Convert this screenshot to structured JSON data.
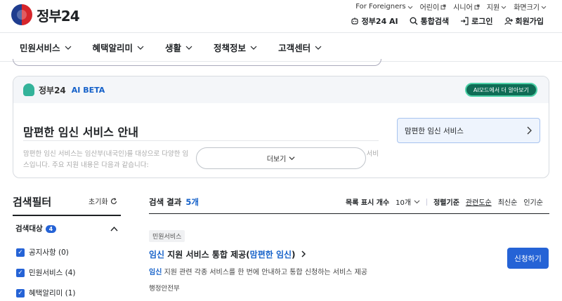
{
  "header": {
    "logo_text": "정부24",
    "util_links": [
      {
        "label": "For Foreigners",
        "icon": "chevron-down-icon"
      },
      {
        "label": "어린이",
        "icon": "external-link-icon"
      },
      {
        "label": "시니어",
        "icon": "external-link-icon"
      },
      {
        "label": "지원",
        "icon": "chevron-down-icon"
      },
      {
        "label": "화면크기",
        "icon": "chevron-down-icon"
      }
    ],
    "main_links": {
      "ai": "정부24 AI",
      "search": "통합검색",
      "login": "로그인",
      "signup": "회원가입"
    }
  },
  "gnb": [
    "민원서비스",
    "혜택알리미",
    "생활",
    "정책정보",
    "고객센터"
  ],
  "ai_box": {
    "brand": "정부24",
    "beta": "AI BETA",
    "mode_button": "AI모드에서 더 알아보기",
    "title": "맘편한 임신 서비스 안내",
    "desc_line1": "맘편한 임신 서비스는 임산부(내국인)를 대상으로 다양한 임",
    "desc_line1_tail": "서비",
    "desc_line2": "스입니다. 주요 지원 내용은 다음과 같습니다:",
    "link_label": "맘편한 임신 서비스",
    "more_button": "더보기"
  },
  "filter": {
    "title": "검색필터",
    "reset": "초기화",
    "target_label": "검색대상",
    "target_count": "4",
    "items": [
      "공지사항 (0)",
      "민원서비스 (4)",
      "혜택알리미 (1)"
    ]
  },
  "results": {
    "label": "검색 결과",
    "count": "5개",
    "per_page_label": "목록 표시 개수",
    "per_page_value": "10개",
    "sort_label": "정렬기준",
    "sort_options": [
      "관련도순",
      "최신순",
      "인기순"
    ],
    "item": {
      "tag": "민원서비스",
      "title_hl1": "임신",
      "title_mid": " 지원 서비스 통합 제공(",
      "title_hl2": "맘편한 임신",
      "title_end": ")",
      "desc_hl": "임신",
      "desc_rest": " 지원 관련 각종 서비스를 한 번에 안내하고 통합 신청하는 서비스 제공",
      "org": "행정안전부",
      "apply_button": "신청하기"
    }
  },
  "colors": {
    "accent": "#2563d6",
    "ai_button": "#0f6c55",
    "link_box": "#eef4fd"
  }
}
